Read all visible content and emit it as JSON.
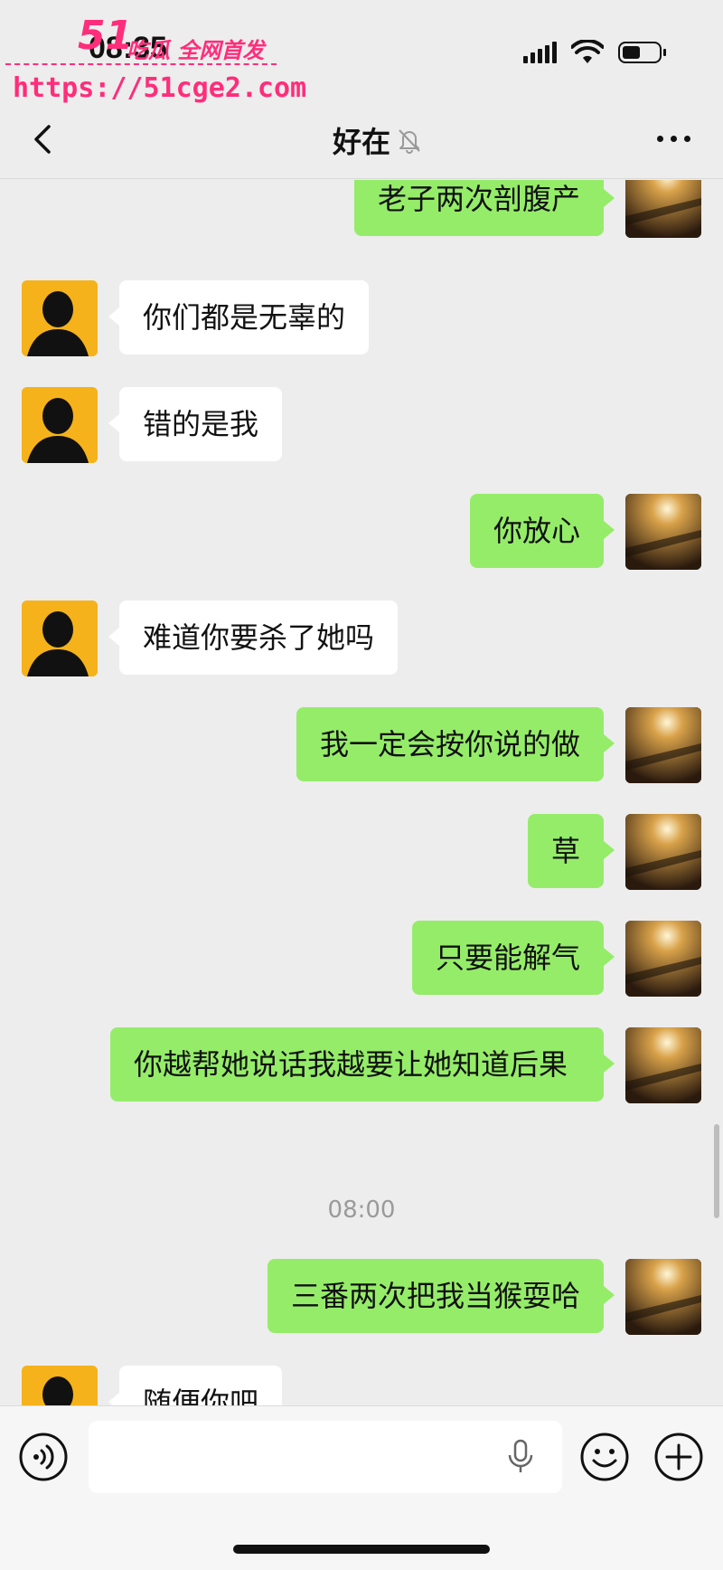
{
  "status_bar": {
    "time": "08:35"
  },
  "watermark": {
    "logo": "51",
    "slogan": "吃瓜 全网首发",
    "url": "https://51cge2.com"
  },
  "nav": {
    "title": "好在"
  },
  "messages": [
    {
      "side": "right",
      "text": "老子两次剖腹产"
    },
    {
      "side": "left",
      "text": "你们都是无辜的"
    },
    {
      "side": "left",
      "text": "错的是我"
    },
    {
      "side": "right",
      "text": "你放心"
    },
    {
      "side": "left",
      "text": "难道你要杀了她吗"
    },
    {
      "side": "right",
      "text": "我一定会按你说的做"
    },
    {
      "side": "right",
      "text": "草"
    },
    {
      "side": "right",
      "text": "只要能解气"
    },
    {
      "side": "right",
      "text": "你越帮她说话我越要让她知道后果"
    },
    {
      "side": "right",
      "text": "三番两次把我当猴耍哈"
    },
    {
      "side": "left",
      "text": "随便你吧"
    }
  ],
  "timestamp": "08:00",
  "colors": {
    "background": "#ededed",
    "outgoing_bubble": "#95ec69",
    "incoming_bubble": "#ffffff",
    "watermark": "#ff2d7a",
    "left_avatar": "#f5b21a"
  },
  "icons": {
    "back": "chevron-left-icon",
    "mute": "bell-slash-icon",
    "more": "more-dots-icon",
    "voice": "voice-icon",
    "mic": "microphone-icon",
    "emoji": "emoji-icon",
    "plus": "plus-icon"
  }
}
